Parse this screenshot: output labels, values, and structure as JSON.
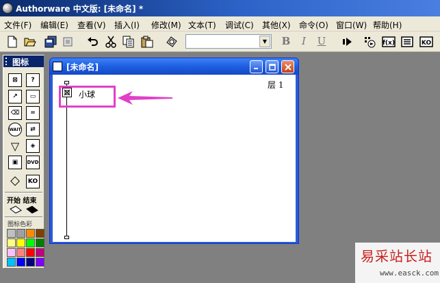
{
  "app": {
    "title": "Authorware 中文版: [未命名] *"
  },
  "menu": [
    "文件(F)",
    "编辑(E)",
    "查看(V)",
    "插入(I)",
    "修改(M)",
    "文本(T)",
    "调试(C)",
    "其他(X)",
    "命令(O)",
    "窗口(W)",
    "帮助(H)"
  ],
  "toolbar": {
    "icons": [
      "new-file-icon",
      "open-icon",
      "save-all-icon",
      "import-icon",
      "undo-icon",
      "cut-icon",
      "copy-icon",
      "paste-icon",
      "find-icon",
      "run-icon",
      "restart-icon",
      "functions-icon",
      "variables-icon",
      "knowledge-objects-icon"
    ],
    "font_combo_value": "",
    "bold_label": "B",
    "italic_label": "I",
    "underline_label": "U",
    "functions_label": "f(x)",
    "ko_label": "KO"
  },
  "palette": {
    "title": "图标",
    "icons": [
      {
        "name": "display-icon",
        "glyph": "⊠"
      },
      {
        "name": "decision-icon",
        "glyph": "?"
      },
      {
        "name": "motion-icon",
        "glyph": "↗"
      },
      {
        "name": "interaction-icon",
        "glyph": "▭"
      },
      {
        "name": "erase-icon",
        "glyph": "⌫"
      },
      {
        "name": "calculation-icon",
        "glyph": "="
      },
      {
        "name": "wait-icon",
        "glyph": "WAIT"
      },
      {
        "name": "navigate-icon",
        "glyph": "⇄"
      },
      {
        "name": "framework-icon",
        "glyph": "▽"
      },
      {
        "name": "map-icon",
        "glyph": "◈"
      },
      {
        "name": "digital-movie-icon",
        "glyph": "▣"
      },
      {
        "name": "dvd-icon",
        "glyph": "DVD"
      },
      {
        "name": "diamond-icon",
        "glyph": "◇"
      },
      {
        "name": "knowledge-object-icon",
        "glyph": "KO"
      }
    ],
    "start_end_label": "开始 结束",
    "color_label": "图标色彩",
    "colors": [
      "#c0c0c0",
      "#a0a0a0",
      "#ff8c00",
      "#804000",
      "#ffff80",
      "#ffff00",
      "#00ff00",
      "#008000",
      "#ffc0ff",
      "#ff8080",
      "#ff0000",
      "#c00080",
      "#00c0ff",
      "#0000ff",
      "#000080",
      "#8000ff"
    ]
  },
  "design_window": {
    "title": "[未命名]",
    "level_label": "层 1",
    "flow_icon": {
      "label": "小球",
      "type": "display"
    }
  },
  "watermark": {
    "brand": "易采站长站",
    "url": "www.easck.com"
  },
  "colors": {
    "highlight": "#e040c8",
    "title_blue": "#1e5ee0",
    "watermark_red": "#c8201e"
  }
}
